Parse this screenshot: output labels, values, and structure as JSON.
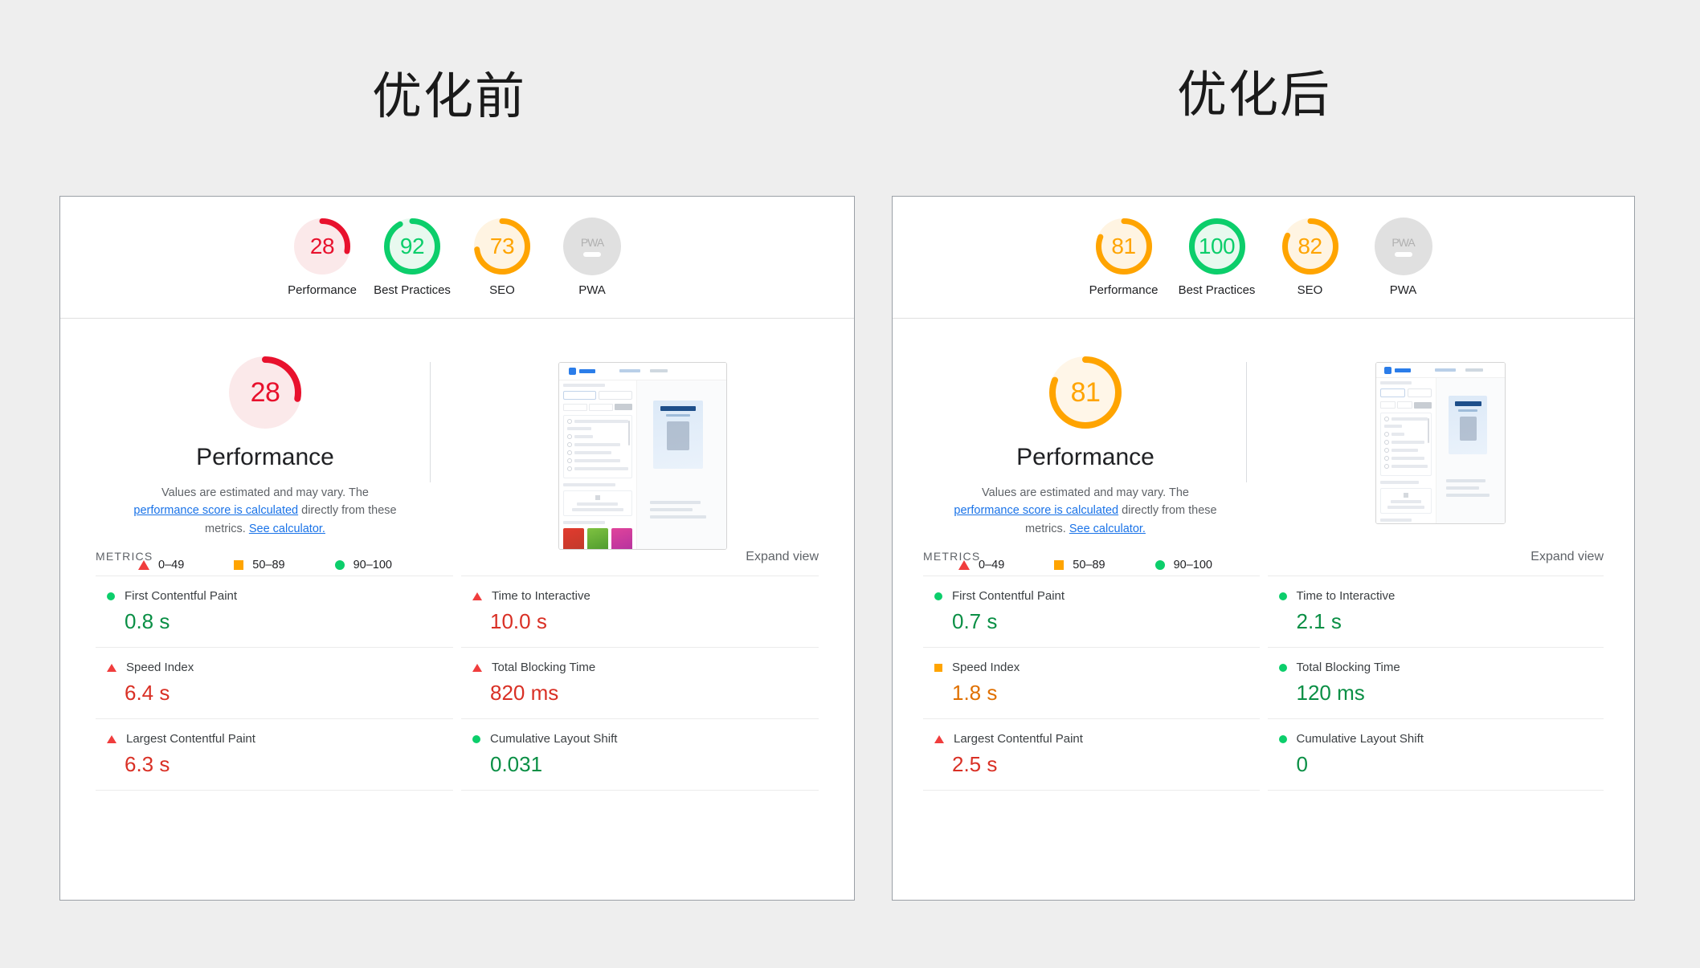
{
  "titles": {
    "before": "优化前",
    "after": "优化后"
  },
  "legend": {
    "desc_part1": "Values are estimated and may vary. The ",
    "link1": "performance score is calculated",
    "desc_part2": " directly from these metrics. ",
    "link2": "See calculator.",
    "items": [
      {
        "shape": "triangle-icon",
        "label": "0–49",
        "color": "#f03d3d"
      },
      {
        "shape": "square-icon",
        "label": "50–89",
        "color": "#ffa400"
      },
      {
        "shape": "circle-icon",
        "label": "90–100",
        "color": "#0cce6b"
      }
    ]
  },
  "metrics_section": {
    "heading": "METRICS",
    "expand": "Expand view"
  },
  "pwa": {
    "text": "PWA"
  },
  "before": {
    "gauges": [
      {
        "score": "28",
        "label": "Performance",
        "pct": 28,
        "color": "#e8112d",
        "bg": "#fbe9ea"
      },
      {
        "score": "92",
        "label": "Best Practices",
        "pct": 92,
        "color": "#0cce6b",
        "bg": "#e8f9ef"
      },
      {
        "score": "73",
        "label": "SEO",
        "pct": 73,
        "color": "#ffa400",
        "bg": "#fff4e2"
      },
      {
        "score": "",
        "label": "PWA",
        "pct": 0,
        "color": "#e0e0e0",
        "bg": "#e0e0e0"
      }
    ],
    "hero": {
      "score": "28",
      "pct": 28,
      "color": "#e8112d",
      "bg": "#fbe9ea",
      "title": "Performance"
    },
    "metrics": [
      {
        "name": "First Contentful Paint",
        "value": "0.8 s",
        "shape": "circle-icon",
        "state": "green"
      },
      {
        "name": "Time to Interactive",
        "value": "10.0 s",
        "shape": "triangle-icon",
        "state": "red"
      },
      {
        "name": "Speed Index",
        "value": "6.4 s",
        "shape": "triangle-icon",
        "state": "red"
      },
      {
        "name": "Total Blocking Time",
        "value": "820 ms",
        "shape": "triangle-icon",
        "state": "red"
      },
      {
        "name": "Largest Contentful Paint",
        "value": "6.3 s",
        "shape": "triangle-icon",
        "state": "red"
      },
      {
        "name": "Cumulative Layout Shift",
        "value": "0.031",
        "shape": "circle-icon",
        "state": "green"
      }
    ]
  },
  "after": {
    "gauges": [
      {
        "score": "81",
        "label": "Performance",
        "pct": 81,
        "color": "#ffa400",
        "bg": "#fff4e2"
      },
      {
        "score": "100",
        "label": "Best Practices",
        "pct": 100,
        "color": "#0cce6b",
        "bg": "#e8f9ef"
      },
      {
        "score": "82",
        "label": "SEO",
        "pct": 82,
        "color": "#ffa400",
        "bg": "#fff4e2"
      },
      {
        "score": "",
        "label": "PWA",
        "pct": 0,
        "color": "#e0e0e0",
        "bg": "#e0e0e0"
      }
    ],
    "hero": {
      "score": "81",
      "pct": 81,
      "color": "#ffa400",
      "bg": "#fff6e8",
      "title": "Performance"
    },
    "metrics": [
      {
        "name": "First Contentful Paint",
        "value": "0.7 s",
        "shape": "circle-icon",
        "state": "green"
      },
      {
        "name": "Time to Interactive",
        "value": "2.1 s",
        "shape": "circle-icon",
        "state": "green"
      },
      {
        "name": "Speed Index",
        "value": "1.8 s",
        "shape": "square-icon",
        "state": "orange"
      },
      {
        "name": "Total Blocking Time",
        "value": "120 ms",
        "shape": "circle-icon",
        "state": "green"
      },
      {
        "name": "Largest Contentful Paint",
        "value": "2.5 s",
        "shape": "triangle-icon",
        "state": "red"
      },
      {
        "name": "Cumulative Layout Shift",
        "value": "0",
        "shape": "circle-icon",
        "state": "green"
      }
    ]
  }
}
